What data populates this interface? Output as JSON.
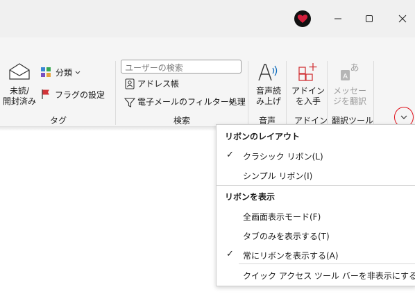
{
  "window": {
    "buttons": {
      "minimize": "minimize",
      "maximize": "maximize",
      "close": "close"
    }
  },
  "ribbon": {
    "tags_group": {
      "title": "タグ",
      "unread_read": "未読/\n開封済み",
      "categorize": "分類",
      "flag": "フラグの設定"
    },
    "search_group": {
      "title": "検索",
      "search_people_placeholder": "ユーザーの検索",
      "address_book": "アドレス帳",
      "filter_email": "電子メールのフィルター処理"
    },
    "speech_group": {
      "title": "音声",
      "read_aloud": "音声読\nみ上げ"
    },
    "addin_group": {
      "title": "アドイン",
      "get_addins": "アドイン\nを入手"
    },
    "translate_group": {
      "title": "翻訳ツール",
      "translate_message": "メッセー\nジを翻訳"
    }
  },
  "menu": {
    "layout_header": "リボンのレイアウト",
    "classic": "クラシック リボン(L)",
    "simplified": "シンプル リボン(I)",
    "show_header": "リボンを表示",
    "fullscreen": "全画面表示モード(F)",
    "tabs_only": "タブのみを表示する(T)",
    "always_show": "常にリボンを表示する(A)",
    "hide_qat": "クイック アクセス ツール バーを非表示にする (H)"
  },
  "colors": {
    "accent": "#0f6cbd",
    "collapse_highlight": "#e0101a",
    "flag_red": "#d13438"
  }
}
